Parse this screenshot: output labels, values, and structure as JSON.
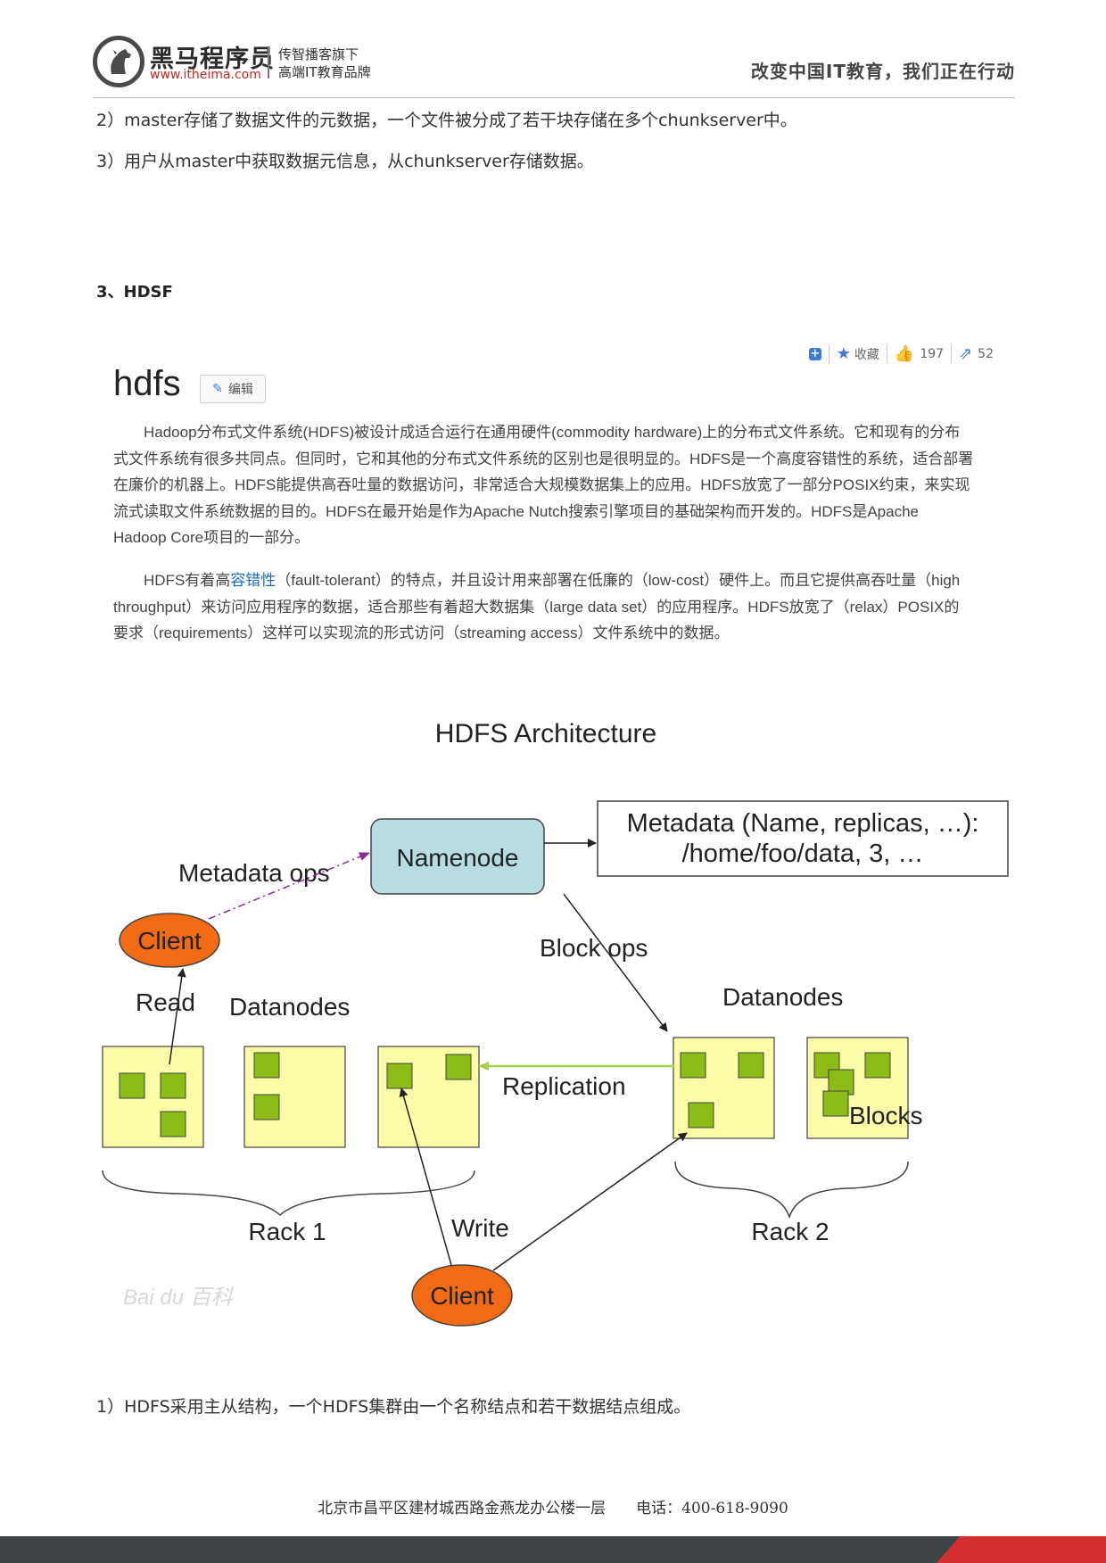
{
  "header": {
    "brand_name": "黑马程序员",
    "brand_url": "www.itheima.com",
    "slogan_line1": "传智播客旗下",
    "slogan_line2": "高端IT教育品牌",
    "tagline": "改变中国IT教育，我们正在行动"
  },
  "body": {
    "line2": "2）master存储了数据文件的元数据，一个文件被分成了若干块存储在多个chunkserver中。",
    "line3": "3）用户从master中获取数据元信息，从chunkserver存储数据。",
    "section_title": "3、HDSF",
    "summary": "1）HDFS采用主从结构，一个HDFS集群由一个名称结点和若干数据结点组成。"
  },
  "baike": {
    "toolbar": {
      "favorite_label": "收藏",
      "like_count": "197",
      "share_count": "52"
    },
    "title": "hdfs",
    "edit_label": "编辑",
    "para1": "Hadoop分布式文件系统(HDFS)被设计成适合运行在通用硬件(commodity hardware)上的分布式文件系统。它和现有的分布式文件系统有很多共同点。但同时，它和其他的分布式文件系统的区别也是很明显的。HDFS是一个高度容错性的系统，适合部署在廉价的机器上。HDFS能提供高吞吐量的数据访问，非常适合大规模数据集上的应用。HDFS放宽了一部分POSIX约束，来实现流式读取文件系统数据的目的。HDFS在最开始是作为Apache Nutch搜索引擎项目的基础架构而开发的。HDFS是Apache Hadoop Core项目的一部分。",
    "para2_pre": "HDFS有着高",
    "para2_link": "容错性",
    "para2_post": "（fault-tolerant）的特点，并且设计用来部署在低廉的（low-cost）硬件上。而且它提供高吞吐量（high throughput）来访问应用程序的数据，适合那些有着超大数据集（large data set）的应用程序。HDFS放宽了（relax）POSIX的要求（requirements）这样可以实现流的形式访问（streaming access）文件系统中的数据。"
  },
  "diagram": {
    "title": "HDFS Architecture",
    "namenode": "Namenode",
    "metadata_line1": "Metadata (Name, replicas, …):",
    "metadata_line2": "/home/foo/data, 3, …",
    "metadata_ops": "Metadata ops",
    "block_ops": "Block ops",
    "client_top": "Client",
    "client_bottom": "Client",
    "read": "Read",
    "write": "Write",
    "datanodes_left": "Datanodes",
    "datanodes_right": "Datanodes",
    "replication": "Replication",
    "blocks": "Blocks",
    "rack1": "Rack 1",
    "rack2": "Rack 2",
    "watermark": "Bai du 百科",
    "colors": {
      "namenode_fill": "#b7dde3",
      "client_fill": "#f26a14",
      "datanode_fill": "#fbfba8",
      "block_fill": "#8cbd16",
      "replication_line": "#a6d14a",
      "metadata_ops_line": "#8a2a9a"
    }
  },
  "footer": {
    "address": "北京市昌平区建材城西路金燕龙办公楼一层　　电话：400-618-9090"
  }
}
